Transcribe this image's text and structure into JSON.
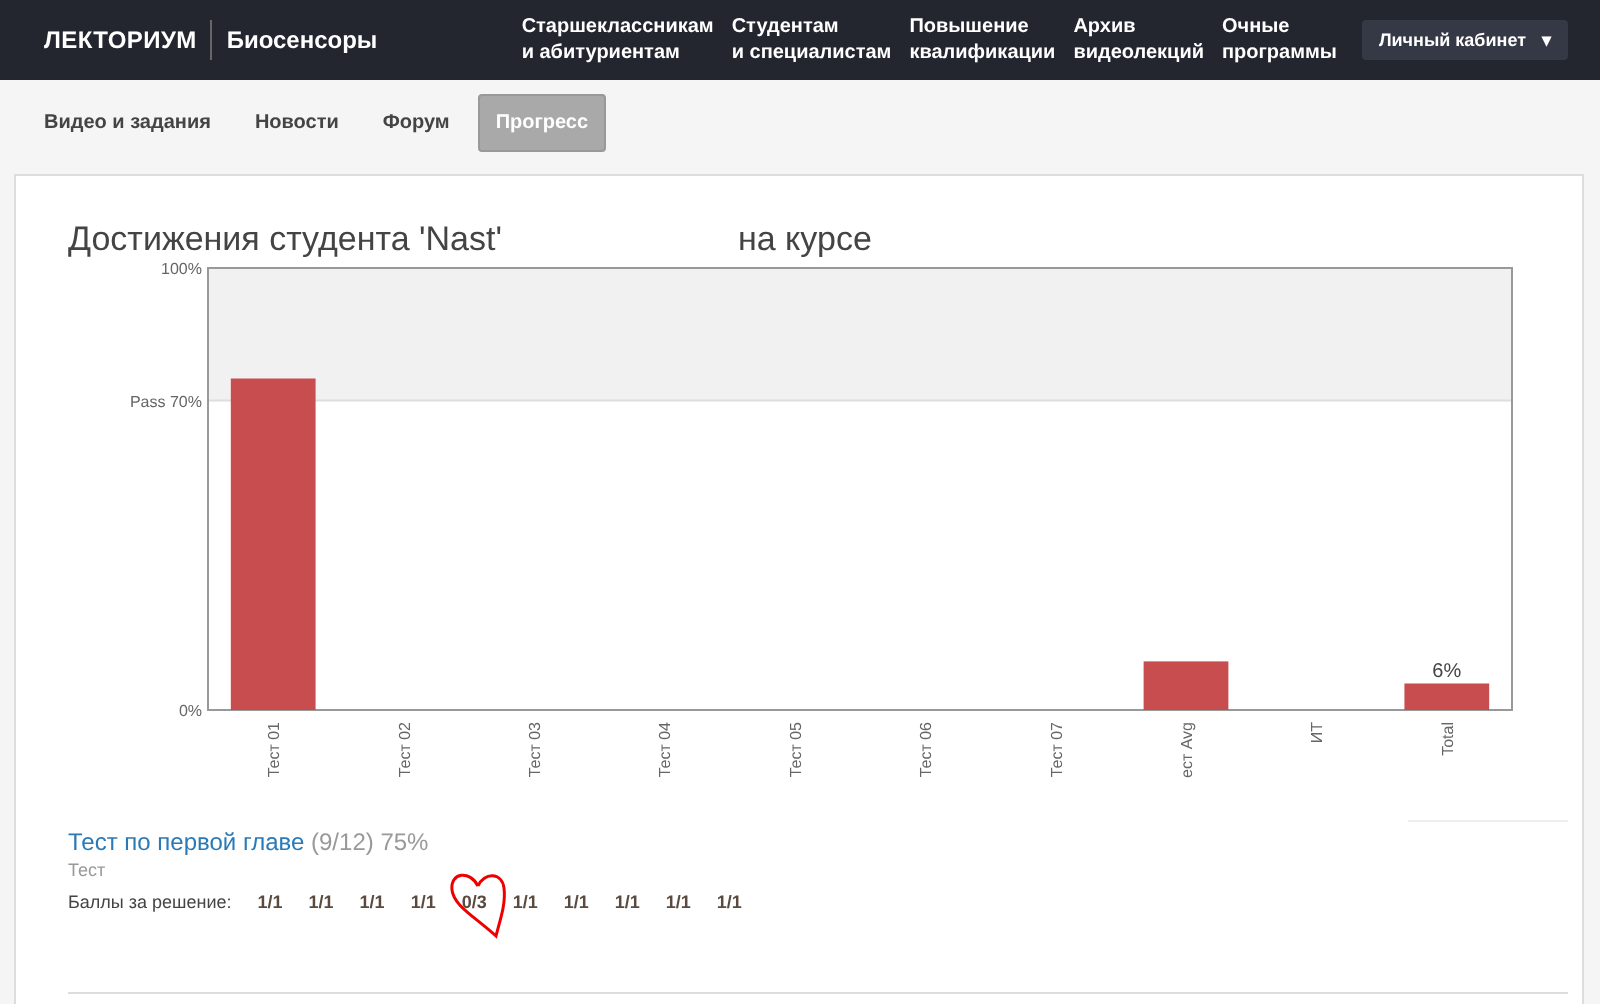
{
  "header": {
    "logo": "ЛЕКТОРИУМ",
    "course": "Биосенсоры",
    "nav": [
      "Старшеклассникам\nи абитуриентам",
      "Студентам\nи специалистам",
      "Повышение\nквалификации",
      "Архив\nвидеолекций",
      "Очные\nпрограммы"
    ],
    "account_button": "Личный кабинет",
    "account_caret": "▾"
  },
  "tabs": [
    {
      "label": "Видео и задания",
      "selected": false
    },
    {
      "label": "Новости",
      "selected": false
    },
    {
      "label": "Форум",
      "selected": false
    },
    {
      "label": "Прогресс",
      "selected": true
    }
  ],
  "progress": {
    "title": "Достижения студента 'Nast'",
    "title_end": "на курсе",
    "chart_data": {
      "type": "bar",
      "categories": [
        "Тест 01",
        "Тест 02",
        "Тест 03",
        "Тест 04",
        "Тест 05",
        "Тест 06",
        "Тест 07",
        "ест Avg",
        "ИТ",
        "Total"
      ],
      "bands": [
        {
          "axis": "y",
          "from": 70,
          "to": 100
        }
      ],
      "series": [
        {
          "color": "#c84d4e",
          "values": [
            75,
            0,
            0,
            0,
            0,
            0,
            0,
            11,
            0,
            6
          ]
        }
      ],
      "ylim": [
        0,
        100
      ],
      "yticks": [
        {
          "value": 0,
          "label": "0%"
        },
        {
          "value": 70,
          "label": "Pass 70%"
        },
        {
          "value": 100,
          "label": "100%"
        }
      ],
      "value_labels": [
        null,
        null,
        null,
        null,
        null,
        null,
        null,
        null,
        null,
        "6%"
      ]
    },
    "section": {
      "title": "Тест по первой главе",
      "score": "(9/12) 75%",
      "subtitle": "Тест",
      "scores_label": "Баллы за решение:",
      "scores": [
        "1/1",
        "1/1",
        "1/1",
        "1/1",
        "0/3",
        "1/1",
        "1/1",
        "1/1",
        "1/1",
        "1/1"
      ]
    }
  }
}
